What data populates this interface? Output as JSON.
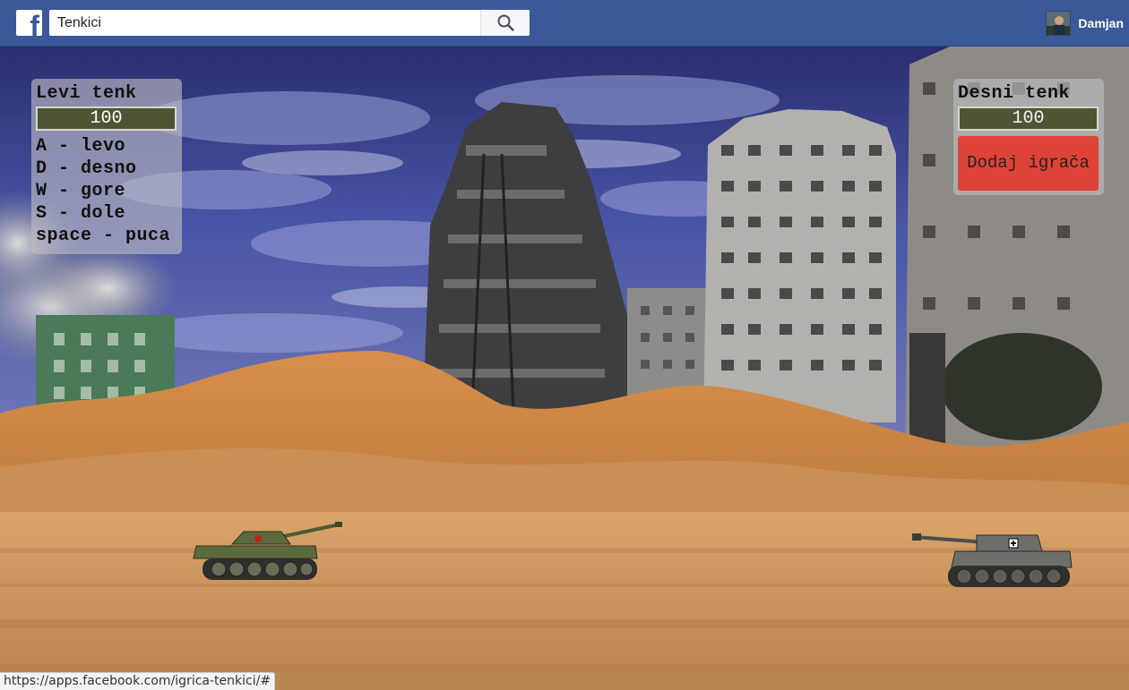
{
  "header": {
    "search_value": "Tenkici",
    "user_name": "Damjan",
    "brand_color": "#3b5998"
  },
  "left_panel": {
    "title": "Levi tenk",
    "health": "100",
    "controls": [
      "A - levo",
      "D - desno",
      "W - gore",
      "S - dole",
      "space - puca"
    ]
  },
  "right_panel": {
    "title": "Desni tenk",
    "health": "100",
    "add_player_label": "Dodaj igrača",
    "add_player_color": "#de4338"
  },
  "status_url": "https://apps.facebook.com/igrica-tenkici/#"
}
